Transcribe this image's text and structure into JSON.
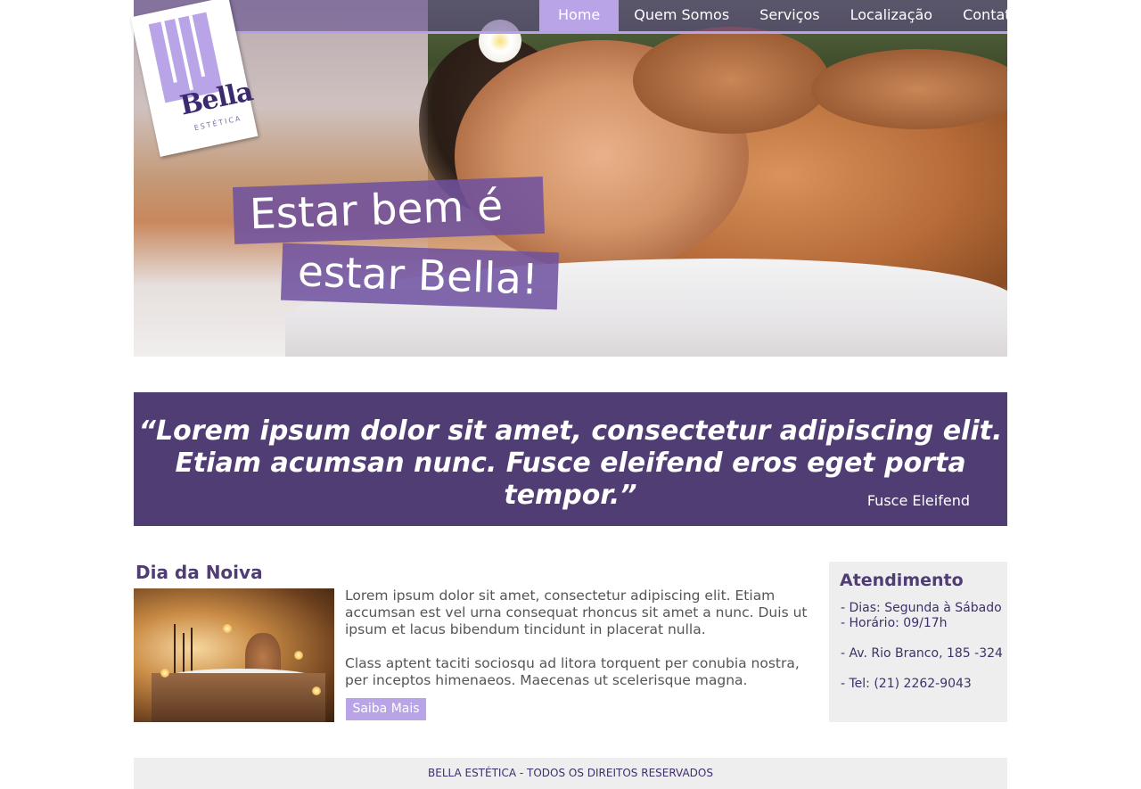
{
  "brand": {
    "logo_name": "Bella",
    "logo_subtitle": "ESTÉTICA"
  },
  "nav": {
    "items": [
      {
        "label": "Home",
        "active": true
      },
      {
        "label": "Quem Somos",
        "active": false
      },
      {
        "label": "Serviços",
        "active": false
      },
      {
        "label": "Localização",
        "active": false
      },
      {
        "label": "Contato",
        "active": false
      }
    ]
  },
  "hero": {
    "slogan_line1": "Estar bem é",
    "slogan_line2": "estar Bella!"
  },
  "quote": {
    "line1": "“Lorem ipsum dolor sit amet, consectetur adipiscing elit.",
    "line2": "Etiam acumsan nunc. Fusce eleifend eros eget porta tempor.”",
    "author": "Fusce Eleifend"
  },
  "feature": {
    "title": "Dia da Noiva",
    "paragraph1": "Lorem ipsum dolor sit amet, consectetur adipiscing elit. Etiam accumsan est vel urna consequat rhoncus sit amet a nunc. Duis ut ipsum et lacus bibendum tincidunt in placerat nulla.",
    "paragraph2": "Class aptent taciti sociosqu ad litora torquent per conubia nostra, per inceptos himenaeos. Maecenas ut scelerisque magna.",
    "button_label": "Saiba Mais"
  },
  "sidebar": {
    "title": "Atendimento",
    "days": "- Dias: Segunda à Sábado",
    "hours": "- Horário: 09/17h",
    "address": "- Av. Rio Branco, 185 -324",
    "phone": "- Tel: (21) 2262-9043"
  },
  "footer": {
    "text": "BELLA ESTÉTICA - TODOS OS DIREITOS RESERVADOS"
  },
  "colors": {
    "brand_purple": "#4f3d74",
    "accent_lilac": "#b8a4e6",
    "panel_gray": "#eeeeee"
  }
}
